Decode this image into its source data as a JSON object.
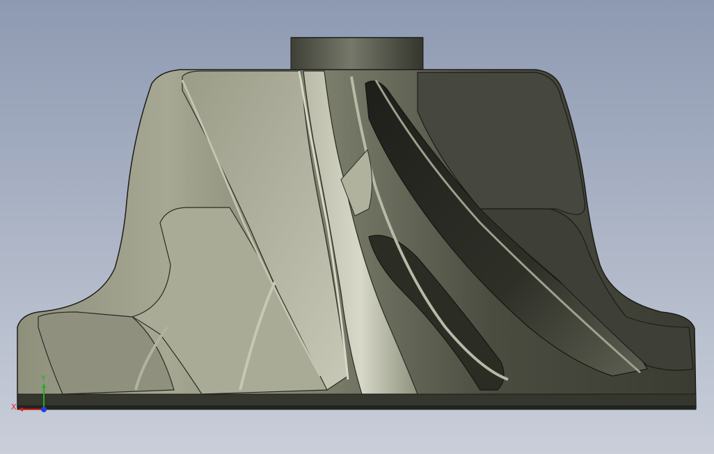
{
  "viewport": {
    "background_top": "#8e9ab2",
    "background_bottom": "#c9ced9"
  },
  "model": {
    "metal_light": "#c8c9bb",
    "metal_mid": "#7a7d6b",
    "metal_dark": "#2c2e26",
    "edge": "#1b1c16"
  },
  "triad": {
    "x_label": "X",
    "y_label": "Y",
    "x_color": "#e02020",
    "y_color": "#20b020",
    "z_color": "#2040e0"
  }
}
